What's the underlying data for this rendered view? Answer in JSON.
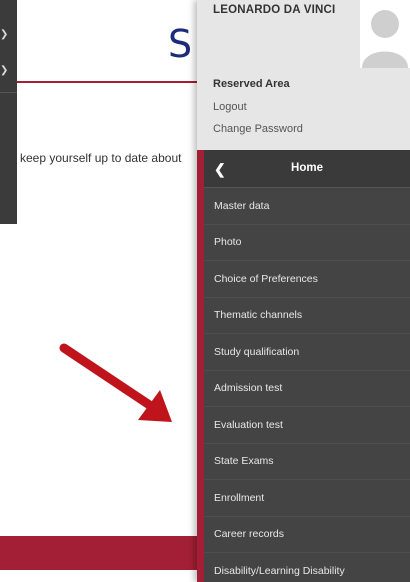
{
  "background": {
    "logo_letter": "S",
    "intro_text": "keep yourself up to date about"
  },
  "sidebar": {
    "user": {
      "name": "LEONARDO DA VINCI",
      "reserved_area_title": "Reserved Area",
      "links": [
        "Logout",
        "Change Password"
      ]
    },
    "home": {
      "back_icon": "chevron-left-icon",
      "label": "Home"
    },
    "menu": [
      "Master data",
      "Photo",
      "Choice of Preferences",
      "Thematic channels",
      "Study qualification",
      "Admission test",
      "Evaluation test",
      "State Exams",
      "Enrollment",
      "Career records",
      "Disability/Learning Disability"
    ]
  },
  "colors": {
    "accent_red": "#a31f35",
    "sidebar_dark": "#3a3a3a",
    "menu_item": "#444444",
    "user_panel": "#e6e6e6",
    "logo_blue": "#1c2b7a",
    "arrow_red": "#c0141c"
  }
}
